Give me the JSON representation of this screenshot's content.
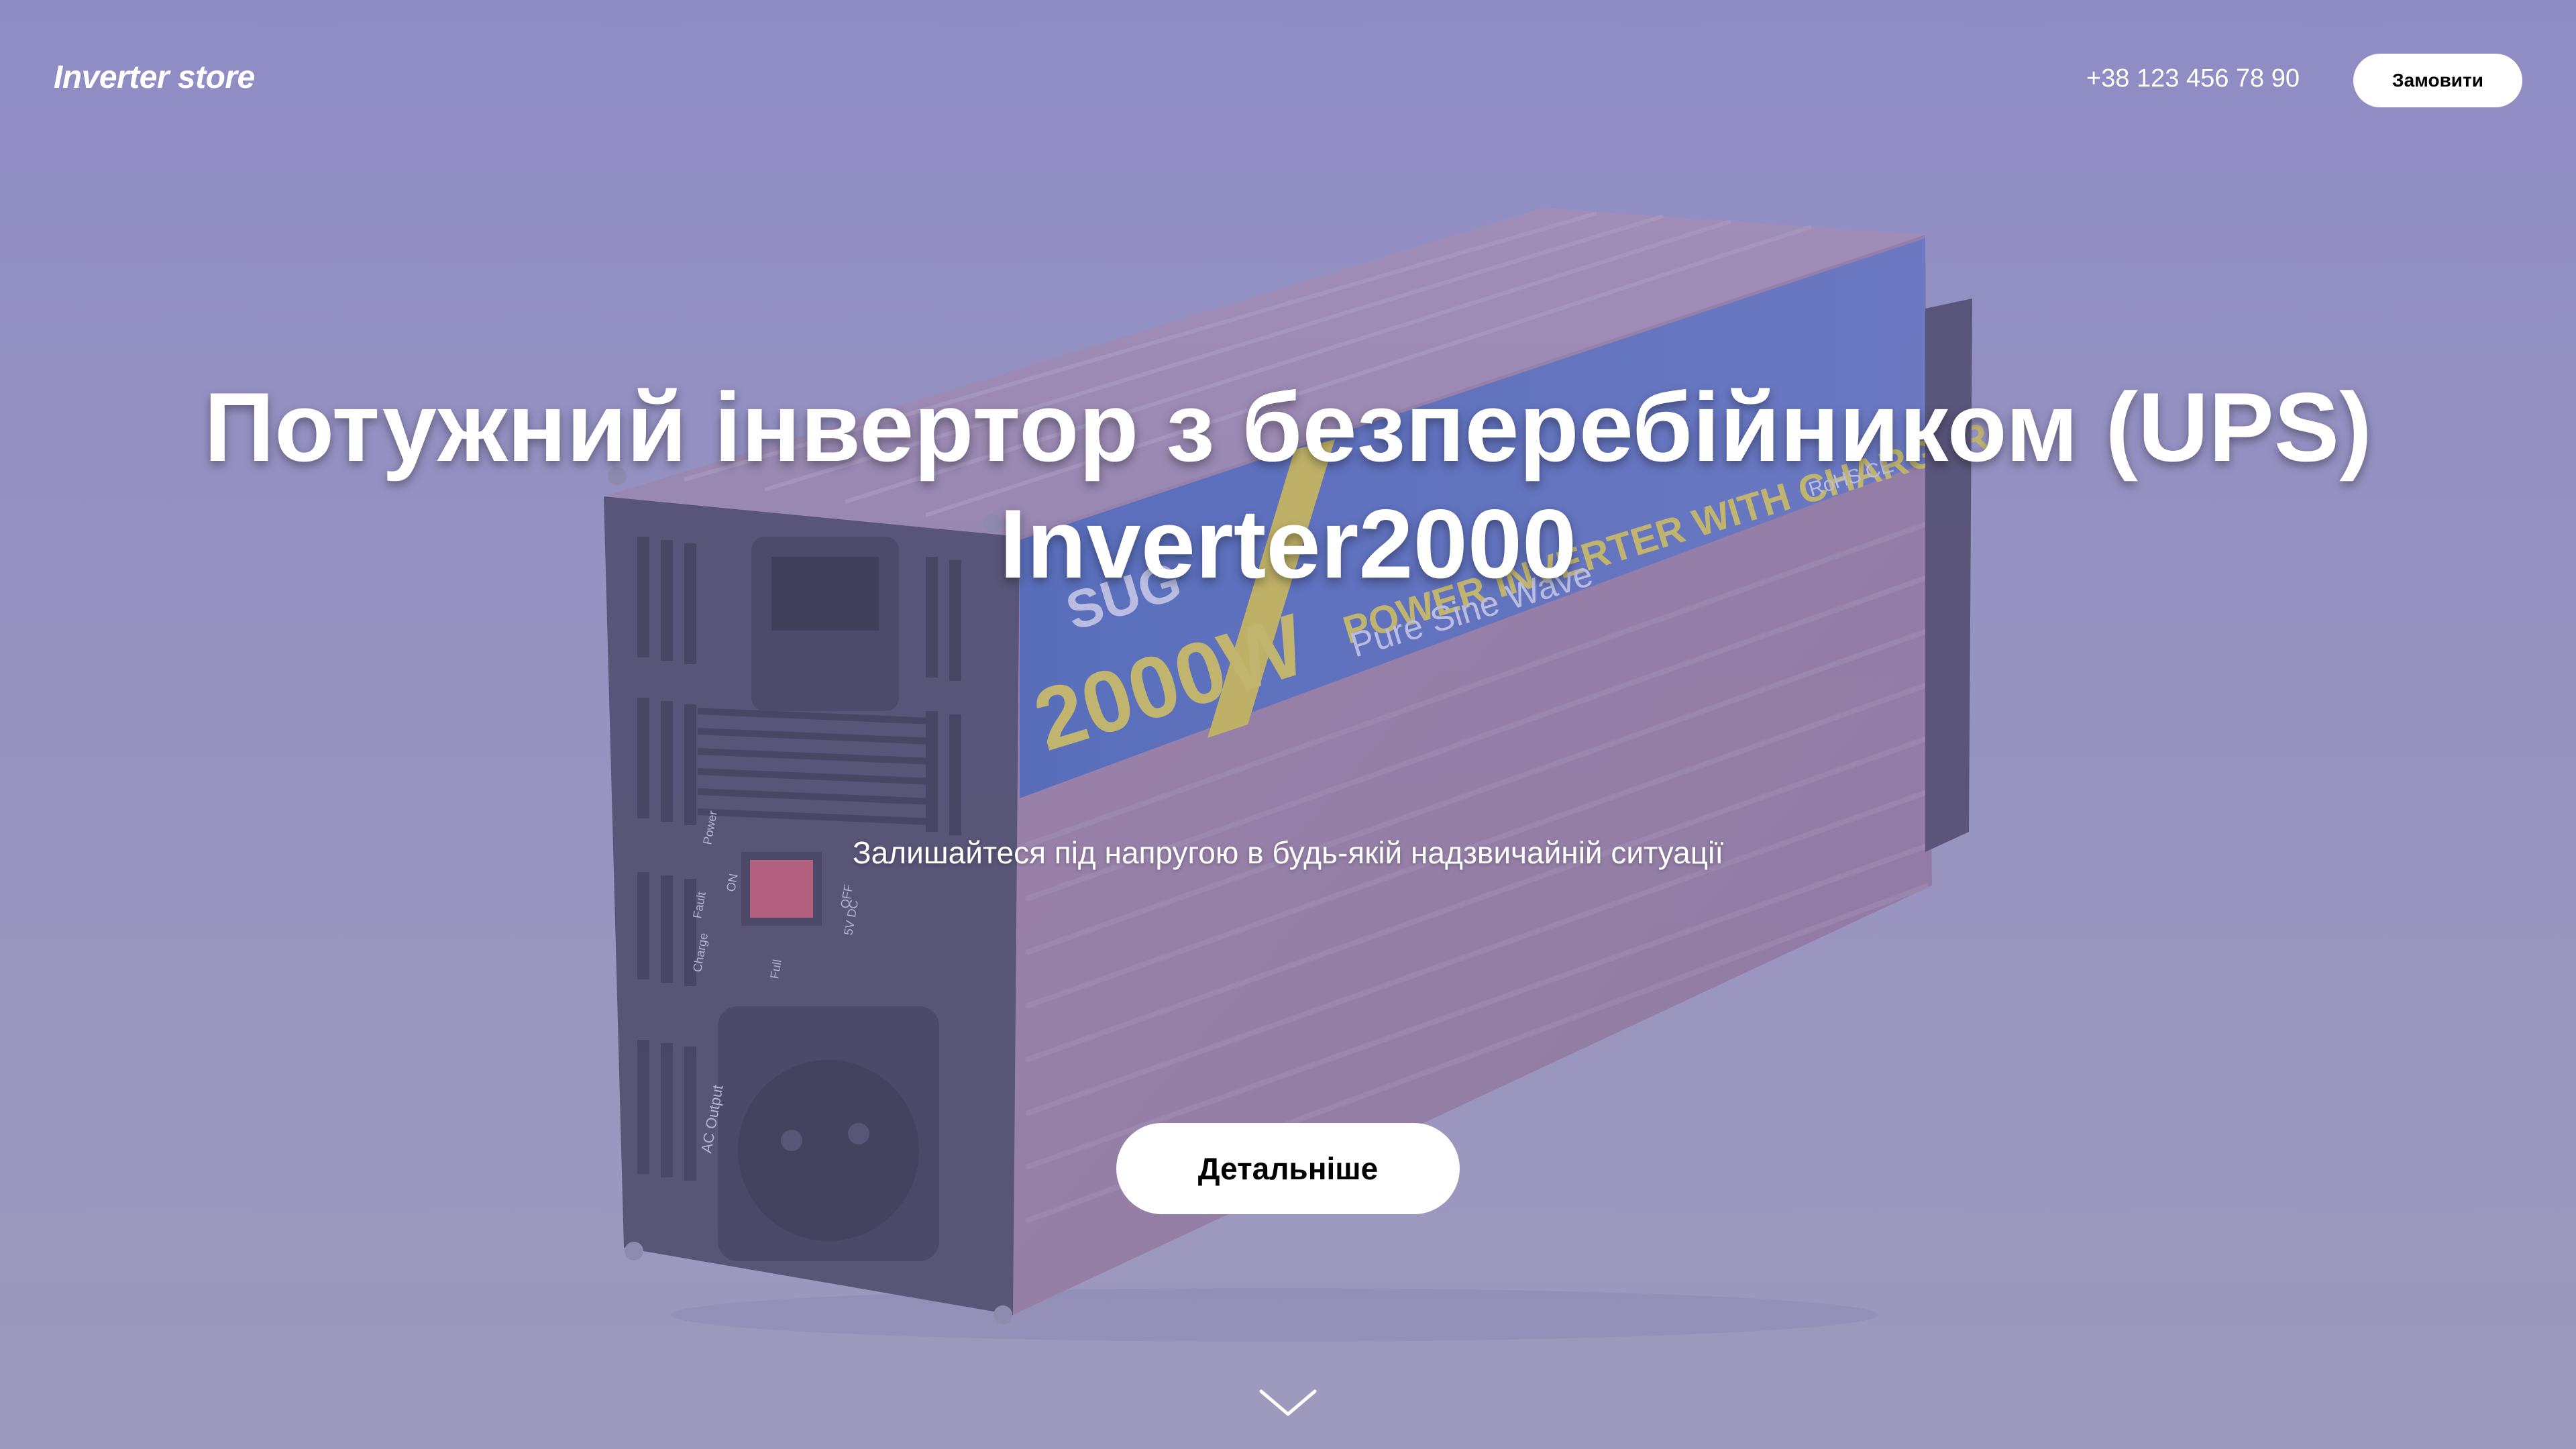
{
  "header": {
    "logo": "Inverter store",
    "phone": "+38 123 456 78 90",
    "order_label": "Замовити"
  },
  "hero": {
    "title": "Потужний інвертор з безперебійником (UPS) Inverter2000",
    "subtitle": "Залишайтеся під напругою в будь-якій надзвичайній ситуації",
    "details_label": "Детальніше",
    "scroll_icon": "chevron-down-icon"
  },
  "product_image": {
    "brand_text": "SUG",
    "power_text": "2000W",
    "banner_text": "POWER INVERTER WITH CHARGER",
    "wave_text": "Pure Sine Wave",
    "cert_text": "RoHS CE",
    "power_label": "Power",
    "on_label": "ON",
    "off_label": "OFF",
    "fault_label": "Fault",
    "charge_label": "Charge",
    "full_label": "Full",
    "usb_label": "5V DC",
    "ac_label": "AC Output"
  },
  "colors": {
    "overlay": "#8f8cc4",
    "button_bg": "#ffffff",
    "text": "#ffffff"
  }
}
